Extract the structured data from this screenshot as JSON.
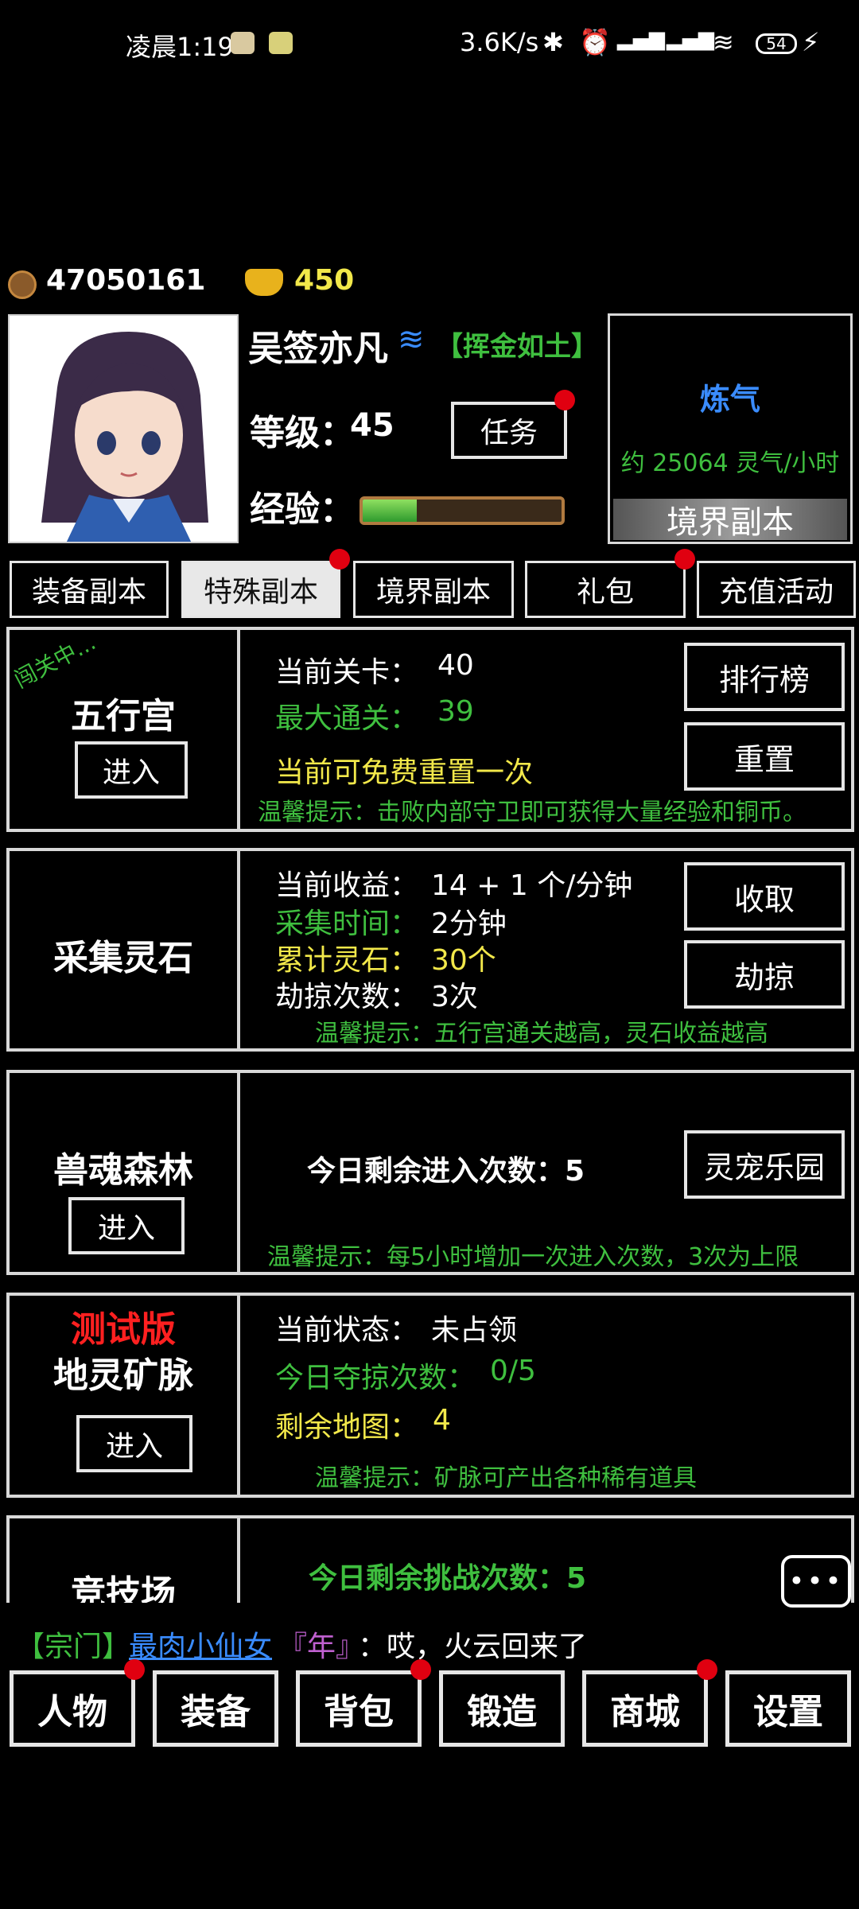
{
  "status_bar": {
    "time": "凌晨1:19",
    "speed": "3.6K/s",
    "battery": "54",
    "icons": [
      "app-icon-1",
      "app-icon-2",
      "bluetooth-icon",
      "alarm-icon",
      "signal-hd-icon",
      "signal-hd-icon",
      "wifi-icon",
      "battery-icon",
      "charging-icon"
    ]
  },
  "currency": {
    "coins": "47050161",
    "gold": "450"
  },
  "player": {
    "name": "吴签亦凡",
    "title": "【挥金如土】",
    "level_label": "等级：",
    "level": "45",
    "exp_label": "经验：",
    "exp_fraction": 0.27,
    "task_button": "任务"
  },
  "realm_box": {
    "realm": "炼气",
    "rate": "约 25064 灵气/小时",
    "button": "境界副本"
  },
  "tabs": [
    "装备副本",
    "特殊副本",
    "境界副本",
    "礼包",
    "充值活动"
  ],
  "wuxing": {
    "badge": "闯关中...",
    "title": "五行宫",
    "enter": "进入",
    "current_label": "当前关卡：",
    "current": "40",
    "max_label": "最大通关：",
    "max": "39",
    "free_reset": "当前可免费重置一次",
    "tip": "温馨提示：击败内部守卫即可获得大量经验和铜币。",
    "rank_button": "排行榜",
    "reset_button": "重置"
  },
  "collect": {
    "title": "采集灵石",
    "income_label": "当前收益：",
    "income": "14 + 1 个/分钟",
    "time_label": "采集时间：",
    "time": "2分钟",
    "total_label": "累计灵石：",
    "total": "30个",
    "rob_label": "劫掠次数：",
    "rob": "3次",
    "tip": "温馨提示：五行宫通关越高，灵石收益越高",
    "collect_button": "收取",
    "rob_button": "劫掠"
  },
  "forest": {
    "title": "兽魂森林",
    "enter": "进入",
    "remaining": "今日剩余进入次数：5",
    "tip": "温馨提示：每5小时增加一次进入次数，3次为上限",
    "pet_button": "灵宠乐园"
  },
  "mine": {
    "beta": "测试版",
    "title": "地灵矿脉",
    "enter": "进入",
    "state_label": "当前状态：",
    "state": "未占领",
    "rob_label": "今日夺掠次数：",
    "rob": "0/5",
    "maps_label": "剩余地图：",
    "maps": "4",
    "tip": "温馨提示：矿脉可产出各种稀有道具"
  },
  "arena": {
    "title": "竞技场",
    "remaining": "今日剩余挑战次数：5"
  },
  "chat": {
    "channel": "【宗门】",
    "user": "最肉小仙女",
    "user_title": "『年』",
    "message": "：哎，火云回来了"
  },
  "nav": [
    "人物",
    "装备",
    "背包",
    "锻造",
    "商城",
    "设置"
  ],
  "colors": {
    "green": "#3fbf3f",
    "yellow": "#f2e84a",
    "red": "#ff2020",
    "blue": "#3a8cff",
    "notify_dot": "#e00010"
  }
}
